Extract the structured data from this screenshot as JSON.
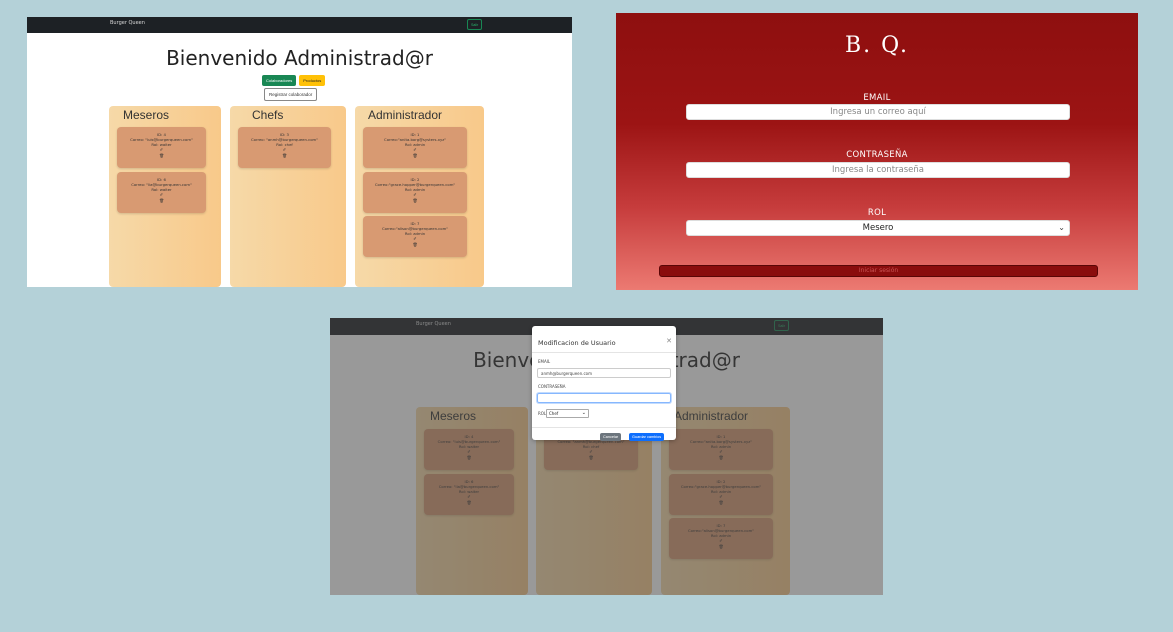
{
  "dashboard": {
    "brand": "Burger Queen",
    "exit_button": "Salir",
    "title": "Bienvenido Administrad@r",
    "btn_colaboradores": "Colaboradores",
    "btn_productos": "Productos",
    "btn_registrar": "Registrar colaborador",
    "columns": [
      {
        "title": "Meseros",
        "cards": [
          {
            "id": "ID: 4",
            "correo": "Correo: \"luis@burgerqueen.com\"",
            "rol": "Rol: waiter",
            "edit": "✐",
            "del": "🗑"
          },
          {
            "id": "ID: 6",
            "correo": "Correo: \"lia@burgerqueen.com\"",
            "rol": "Rol: waiter",
            "edit": "✐",
            "del": "🗑"
          }
        ]
      },
      {
        "title": "Chefs",
        "cards": [
          {
            "id": "ID: 3",
            "correo": "Correo: \"anmh@burgerqueen.com\"",
            "rol": "Rol: chef",
            "edit": "✐",
            "del": "🗑"
          }
        ]
      },
      {
        "title": "Administrador",
        "cards": [
          {
            "id": "ID: 1",
            "correo": "Correo:\"anita.borg@systers.xyz\"",
            "rol": "Rol: admin",
            "edit": "✐",
            "del": "🗑"
          },
          {
            "id": "ID: 2",
            "correo": "Correo:\"grace.hopper@burgerqueen.com\"",
            "rol": "Rol: admin",
            "edit": "✐",
            "del": "🗑"
          },
          {
            "id": "ID: 7",
            "correo": "Correo:\"alison@burgerqueen.com\"",
            "rol": "Rol: admin",
            "edit": "✐",
            "del": "🗑"
          }
        ]
      }
    ]
  },
  "login": {
    "logo": "B. Q.",
    "email_label": "EMAIL",
    "email_placeholder": "Ingresa un correo aquí",
    "password_label": "CONTRASEÑA",
    "password_placeholder": "Ingresa la contraseña",
    "rol_label": "ROL",
    "rol_value": "Mesero",
    "submit_label": "Iniciar sesión"
  },
  "modal": {
    "title": "Modificacion de Usuario",
    "email_label": "EMAIL",
    "email_value": "anmh@burgerqueen.com",
    "password_label": "CONTRASEÑA",
    "rol_label": "ROL",
    "rol_value": "Chef",
    "cancel_label": "Cancelar",
    "save_label": "Guardar cambios"
  }
}
